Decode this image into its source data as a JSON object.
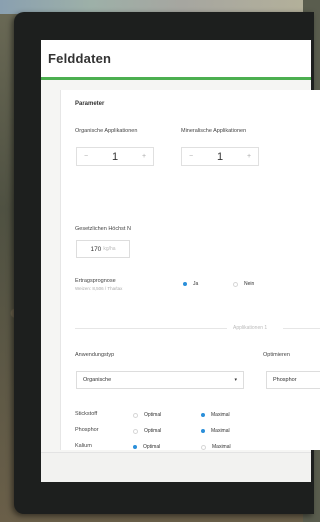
{
  "window": {
    "title": "Felddaten"
  },
  "parameters": {
    "section_title": "Parameter",
    "organic_label": "Organische Applikationen",
    "mineral_label": "Mineralische Applikationen",
    "organic_value": "1",
    "mineral_value": "1",
    "stepper_minus": "−",
    "stepper_plus": "+",
    "nitrogen_label": "Gesetzlichen Höchst N",
    "nitrogen_value": "170",
    "nitrogen_unit": "kg/ha"
  },
  "yield": {
    "label": "Ertragsprognose",
    "hint": "Weizen: 8,506 / Tha/tax",
    "yes_label": "Ja",
    "no_label": "Nein",
    "selected": "Ja"
  },
  "divider": {
    "label": "Applikationen 1"
  },
  "application": {
    "type_label": "Anwendungstyp",
    "type_value": "Organische",
    "caret": "▾",
    "optimize_label": "Optimieren",
    "optimize_value": "Phosphor"
  },
  "nutrients": {
    "optimal_label": "Optimal",
    "maximal_label": "Maximal",
    "rows": [
      {
        "name": "Stickstoff",
        "selected": "Maximal"
      },
      {
        "name": "Phosphor",
        "selected": "Maximal"
      },
      {
        "name": "Kalium",
        "selected": "Optimal"
      }
    ]
  },
  "colors": {
    "accent_green": "#4caf50",
    "radio_blue": "#2b8fd9"
  }
}
